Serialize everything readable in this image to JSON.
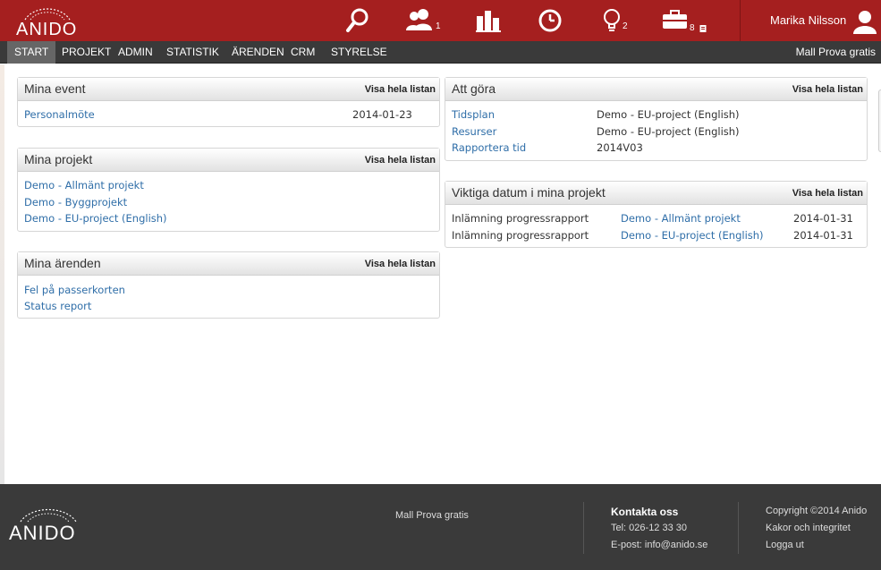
{
  "brand": {
    "name": "ANIDO"
  },
  "header": {
    "icons": [
      {
        "name": "search-icon",
        "count": ""
      },
      {
        "name": "users-icon",
        "count": "1"
      },
      {
        "name": "chart-icon",
        "count": ""
      },
      {
        "name": "clock-icon",
        "count": ""
      },
      {
        "name": "lightbulb-icon",
        "count": "2"
      },
      {
        "name": "briefcase-icon",
        "count": "8"
      }
    ],
    "user_name": "Marika Nilsson"
  },
  "menu": {
    "items": [
      "START",
      "PROJEKT",
      "ADMIN",
      "STATISTIK",
      "ÄRENDEN",
      "CRM",
      "STYRELSE"
    ],
    "active": "START",
    "promo": "Mall Prova gratis"
  },
  "boxes": {
    "events": {
      "title": "Mina event",
      "link": "Visa hela listan",
      "rows": [
        {
          "name": "Personalmöte",
          "date": "2014-01-23"
        }
      ]
    },
    "projects": {
      "title": "Mina projekt",
      "link": "Visa hela listan",
      "rows": [
        "Demo - Allmänt projekt",
        "Demo - Byggprojekt",
        "Demo - EU-project (English)"
      ]
    },
    "cases": {
      "title": "Mina ärenden",
      "link": "Visa hela listan",
      "rows": [
        "Fel på passerkorten",
        "Status report"
      ]
    },
    "todo": {
      "title": "Att göra",
      "link": "Visa hela listan",
      "rows": [
        {
          "task": "Tidsplan",
          "project": "Demo - EU-project (English)"
        },
        {
          "task": "Resurser",
          "project": "Demo - EU-project (English)"
        },
        {
          "task": "Rapportera tid",
          "project": "2014V03"
        }
      ]
    },
    "dates": {
      "title": "Viktiga datum i mina projekt",
      "link": "Visa hela listan",
      "rows": [
        {
          "what": "Inlämning progressrapport",
          "project": "Demo - Allmänt projekt",
          "date": "2014-01-31"
        },
        {
          "what": "Inlämning progressrapport",
          "project": "Demo - EU-project (English)",
          "date": "2014-01-31"
        }
      ]
    }
  },
  "footer": {
    "promo": "Mall Prova gratis",
    "contact_title": "Kontakta oss",
    "phone": "Tel: 026-12 33 30",
    "email": "E-post: info@anido.se",
    "copyright": "Copyright ©2014 Anido",
    "cookies": "Kakor och integritet",
    "logout": "Logga ut"
  },
  "colors": {
    "brand_red": "#a51f1f",
    "menu_bg": "#3a3a3a",
    "link_blue": "#2f6ea8"
  }
}
